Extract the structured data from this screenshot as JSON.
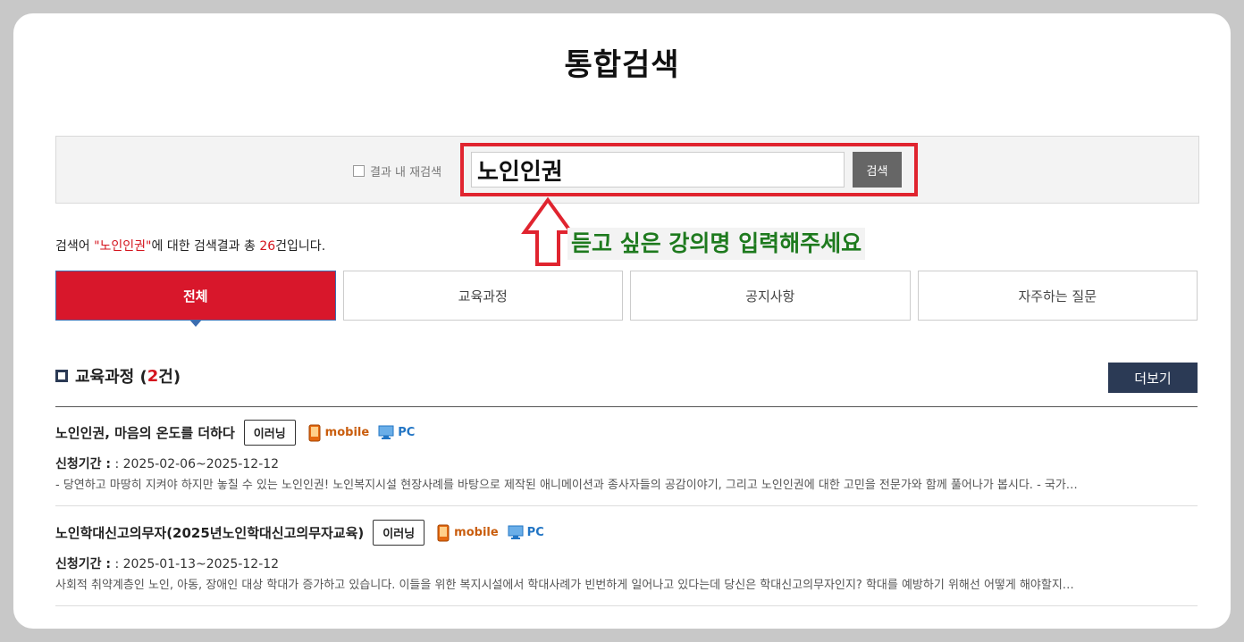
{
  "page": {
    "title": "통합검색"
  },
  "search": {
    "refine_label": "결과 내 재검색",
    "query": "노인인권",
    "placeholder": "",
    "button_label": "검색"
  },
  "hint": {
    "text": "듣고 싶은 강의명 입력해주세요"
  },
  "summary": {
    "prefix": "검색어 ",
    "keyword": "\"노인인권\"",
    "middle": "에 대한 검색결과 총 ",
    "count": "26",
    "suffix": "건입니다."
  },
  "tabs": [
    {
      "label": "전체"
    },
    {
      "label": "교육과정"
    },
    {
      "label": "공지사항"
    },
    {
      "label": "자주하는 질문"
    }
  ],
  "section": {
    "title": "교육과정 (",
    "count": "2",
    "title_end": "건)",
    "more_label": "더보기"
  },
  "items": [
    {
      "title": "노인인권, 마음의 온도를 더하다",
      "badge": "이러닝",
      "mobile": "mobile",
      "pc": "PC",
      "period_label": "신청기간 :",
      "period": " : 2025-02-06~2025-12-12",
      "desc": "- 당연하고 마땅히 지켜야 하지만 놓칠 수 있는 노인인권! 노인복지시설 현장사례를 바탕으로 제작된 애니메이션과 종사자들의 공감이야기, 그리고 노인인권에 대한 고민을 전문가와 함께 풀어나가 봅시다. - 국가…"
    },
    {
      "title": "노인학대신고의무자(2025년노인학대신고의무자교육)",
      "badge": "이러닝",
      "mobile": "mobile",
      "pc": "PC",
      "period_label": "신청기간 :",
      "period": " : 2025-01-13~2025-12-12",
      "desc": "사회적 취약계층인 노인, 아동, 장애인 대상 학대가 증가하고 있습니다. 이들을 위한 복지시설에서 학대사례가 빈번하게 일어나고 있다는데 당신은 학대신고의무자인지? 학대를 예방하기 위해선 어떻게 해야할지…"
    }
  ],
  "colors": {
    "accent_red": "#d8172b",
    "navy": "#2b3a55",
    "hint_green": "#1e7a1e",
    "mobile_orange": "#c95d0d",
    "pc_blue": "#2275c4"
  }
}
